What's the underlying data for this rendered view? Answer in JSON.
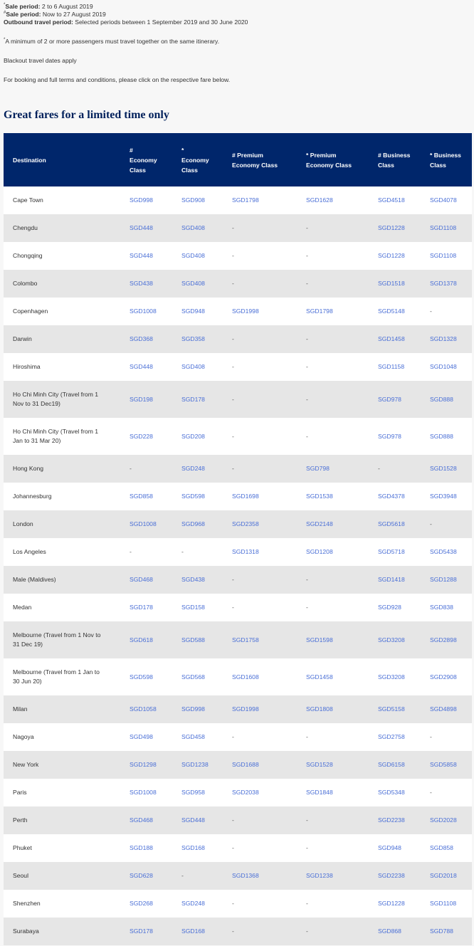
{
  "info": {
    "sale1": {
      "mark": "*",
      "label": "Sale period:",
      "text": " 2 to 6 August 2019"
    },
    "sale2": {
      "mark": "#",
      "label": "Sale period:",
      "text": " Now to 27 August 2019"
    },
    "outbound": {
      "label": "Outbound travel period:",
      "text": " Selected periods between 1 September 2019 and 30 June 2020"
    },
    "minimum": {
      "mark": "*",
      "text": "A minimum of 2 or more passengers must travel together on the same itinerary."
    },
    "blackout": "Blackout travel dates apply",
    "booking": "For booking and full terms and conditions, please click on the respective fare below."
  },
  "title": "Great fares for a limited time only",
  "table": {
    "headers": [
      {
        "line1": "Destination",
        "line2": "",
        "line3": ""
      },
      {
        "line1": "#",
        "line2": "Economy",
        "line3": "Class"
      },
      {
        "line1": "*",
        "line2": "Economy",
        "line3": "Class"
      },
      {
        "line1": "# Premium",
        "line2": "Economy Class",
        "line3": ""
      },
      {
        "line1": "* Premium",
        "line2": "Economy Class",
        "line3": ""
      },
      {
        "line1": "# Business",
        "line2": "Class",
        "line3": ""
      },
      {
        "line1": "* Business",
        "line2": "Class",
        "line3": ""
      }
    ],
    "rows": [
      [
        "Cape Town",
        "SGD998",
        "SGD908",
        "SGD1798",
        "SGD1628",
        "SGD4518",
        "SGD4078"
      ],
      [
        "Chengdu",
        "SGD448",
        "SGD408",
        "-",
        "-",
        "SGD1228",
        "SGD1108"
      ],
      [
        "Chongqing",
        "SGD448",
        "SGD408",
        "-",
        "-",
        "SGD1228",
        "SGD1108"
      ],
      [
        "Colombo",
        "SGD438",
        "SGD408",
        "-",
        "-",
        "SGD1518",
        "SGD1378"
      ],
      [
        "Copenhagen",
        "SGD1008",
        "SGD948",
        "SGD1998",
        "SGD1798",
        "SGD5148",
        "-"
      ],
      [
        "Darwin",
        "SGD368",
        "SGD358",
        "-",
        "-",
        "SGD1458",
        "SGD1328"
      ],
      [
        "Hiroshima",
        "SGD448",
        "SGD408",
        "-",
        "-",
        "SGD1158",
        "SGD1048"
      ],
      [
        "Ho Chi Minh City (Travel from 1 Nov to 31 Dec19)",
        "SGD198",
        "SGD178",
        "-",
        "-",
        "SGD978",
        "SGD888"
      ],
      [
        "Ho Chi Minh City (Travel from 1 Jan to 31 Mar 20)",
        "SGD228",
        "SGD208",
        "-",
        "-",
        "SGD978",
        "SGD888"
      ],
      [
        "Hong Kong",
        "-",
        "SGD248",
        "-",
        "SGD798",
        "-",
        "SGD1528"
      ],
      [
        "Johannesburg",
        "SGD858",
        "SGD598",
        "SGD1698",
        "SGD1538",
        "SGD4378",
        "SGD3948"
      ],
      [
        "London",
        "SGD1008",
        "SGD968",
        "SGD2358",
        "SGD2148",
        "SGD5618",
        "-"
      ],
      [
        "Los Angeles",
        "-",
        "-",
        "SGD1318",
        "SGD1208",
        "SGD5718",
        "SGD5438"
      ],
      [
        "Male (Maldives)",
        "SGD468",
        "SGD438",
        "-",
        "-",
        "SGD1418",
        "SGD1288"
      ],
      [
        "Medan",
        "SGD178",
        "SGD158",
        "-",
        "-",
        "SGD928",
        "SGD838"
      ],
      [
        "Melbourne (Travel from 1 Nov to 31 Dec 19)",
        "SGD618",
        "SGD588",
        "SGD1758",
        "SGD1598",
        "SGD3208",
        "SGD2898"
      ],
      [
        "Melbourne (Travel from 1 Jan to 30 Jun 20)",
        "SGD598",
        "SGD568",
        "SGD1608",
        "SGD1458",
        "SGD3208",
        "SGD2908"
      ],
      [
        "Milan",
        "SGD1058",
        "SGD998",
        "SGD1998",
        "SGD1808",
        "SGD5158",
        "SGD4898"
      ],
      [
        "Nagoya",
        "SGD498",
        "SGD458",
        "-",
        "-",
        "SGD2758",
        "-"
      ],
      [
        "New York",
        "SGD1298",
        "SGD1238",
        "SGD1688",
        "SGD1528",
        "SGD6158",
        "SGD5858"
      ],
      [
        "Paris",
        "SGD1008",
        "SGD958",
        "SGD2038",
        "SGD1848",
        "SGD5348",
        "-"
      ],
      [
        "Perth",
        "SGD468",
        "SGD448",
        "-",
        "-",
        "SGD2238",
        "SGD2028"
      ],
      [
        "Phuket",
        "SGD188",
        "SGD168",
        "-",
        "-",
        "SGD948",
        "SGD858"
      ],
      [
        "Seoul",
        "SGD628",
        "-",
        "SGD1368",
        "SGD1238",
        "SGD2238",
        "SGD2018"
      ],
      [
        "Shenzhen",
        "SGD268",
        "SGD248",
        "-",
        "-",
        "SGD1228",
        "SGD1108"
      ],
      [
        "Surabaya",
        "SGD178",
        "SGD168",
        "-",
        "-",
        "SGD868",
        "SGD788"
      ]
    ]
  },
  "colors": {
    "header_bg": "#00266b",
    "title": "#00205b",
    "link": "#4a6fd6",
    "row_alt": "#e6e6e6"
  }
}
